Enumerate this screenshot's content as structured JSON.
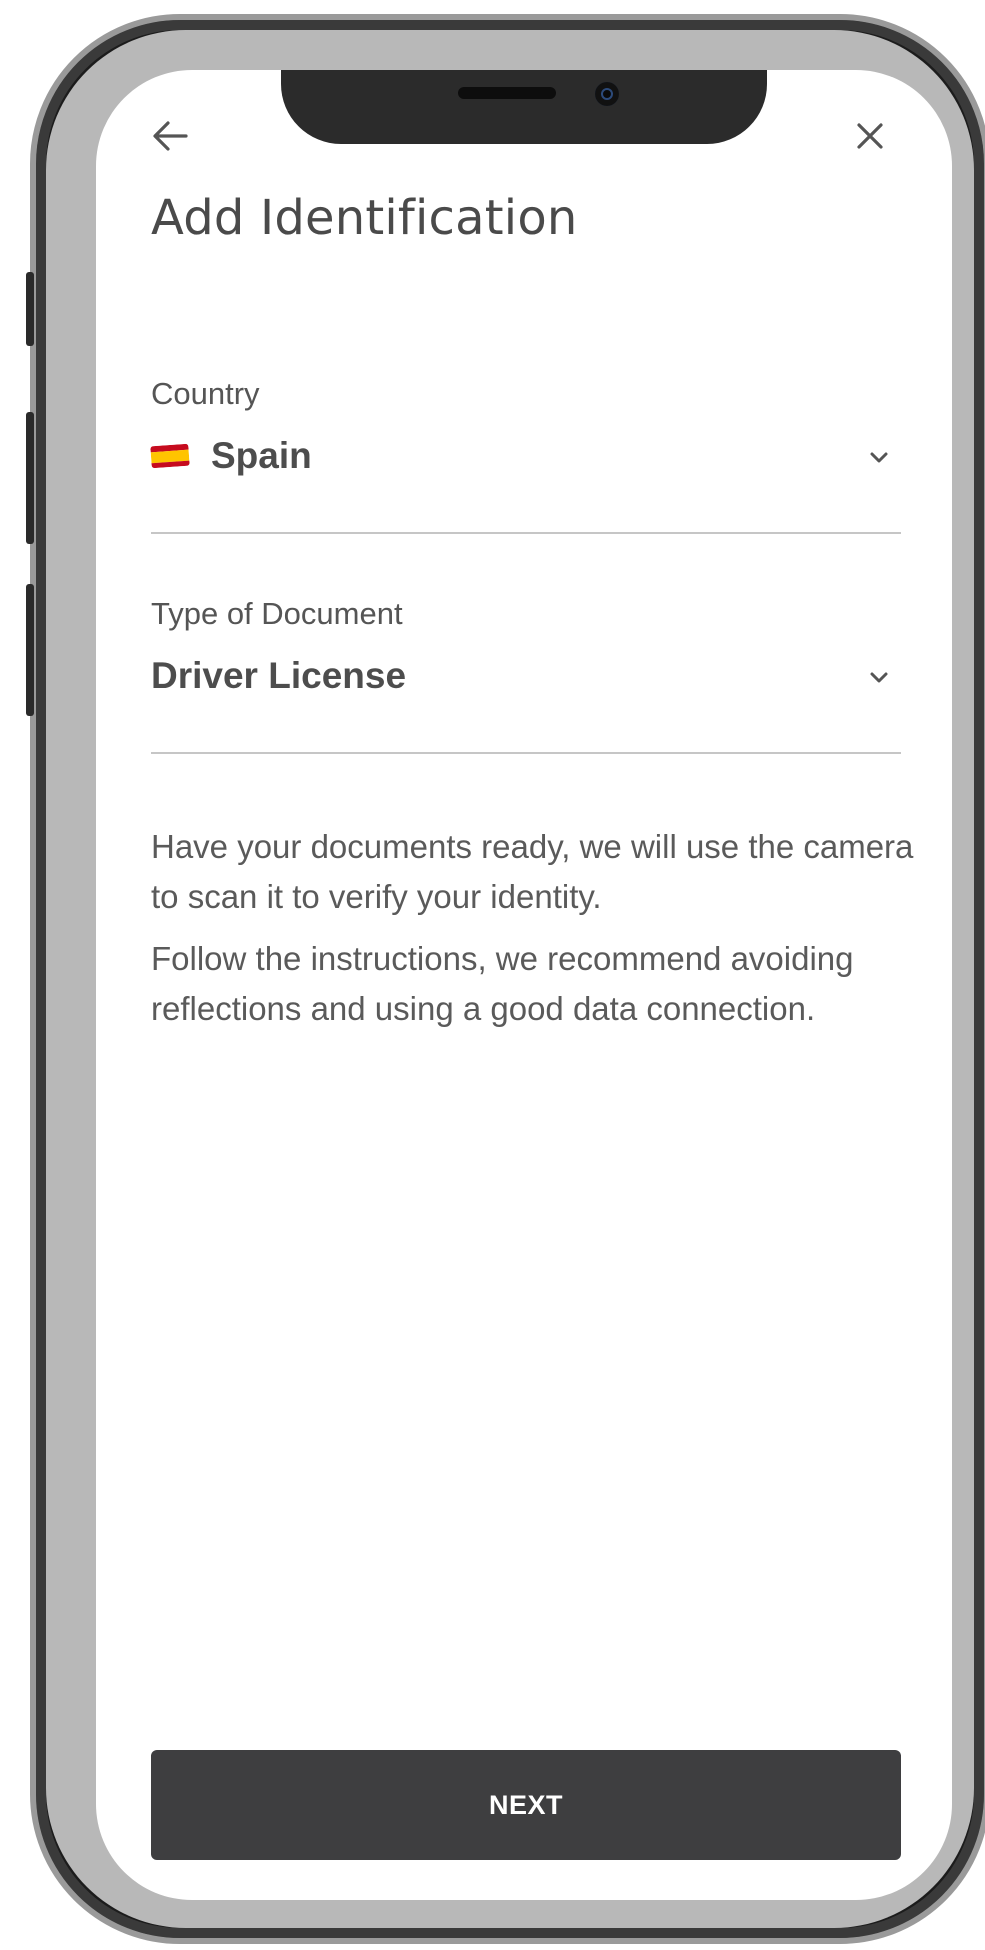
{
  "header": {
    "back_icon": "arrow-left-icon",
    "close_icon": "close-icon",
    "title": "Add Identification"
  },
  "country_field": {
    "label": "Country",
    "flag_icon": "spain-flag-icon",
    "value": "Spain",
    "dropdown_icon": "chevron-down-icon"
  },
  "document_field": {
    "label": "Type of Document",
    "value": "Driver License",
    "dropdown_icon": "chevron-down-icon"
  },
  "info": {
    "paragraph_1": "Have your documents ready, we will use the camera to scan it to verify your identity.",
    "paragraph_2": "Follow the instructions, we recommend avoiding reflections and using a good data connection."
  },
  "actions": {
    "next_label": "NEXT"
  },
  "colors": {
    "text_primary": "#4a4a4a",
    "divider": "#c6c6c6",
    "button_bg": "#3e3e40",
    "button_text": "#ffffff",
    "flag_red": "#c60b1e",
    "flag_yellow": "#ffc400"
  }
}
